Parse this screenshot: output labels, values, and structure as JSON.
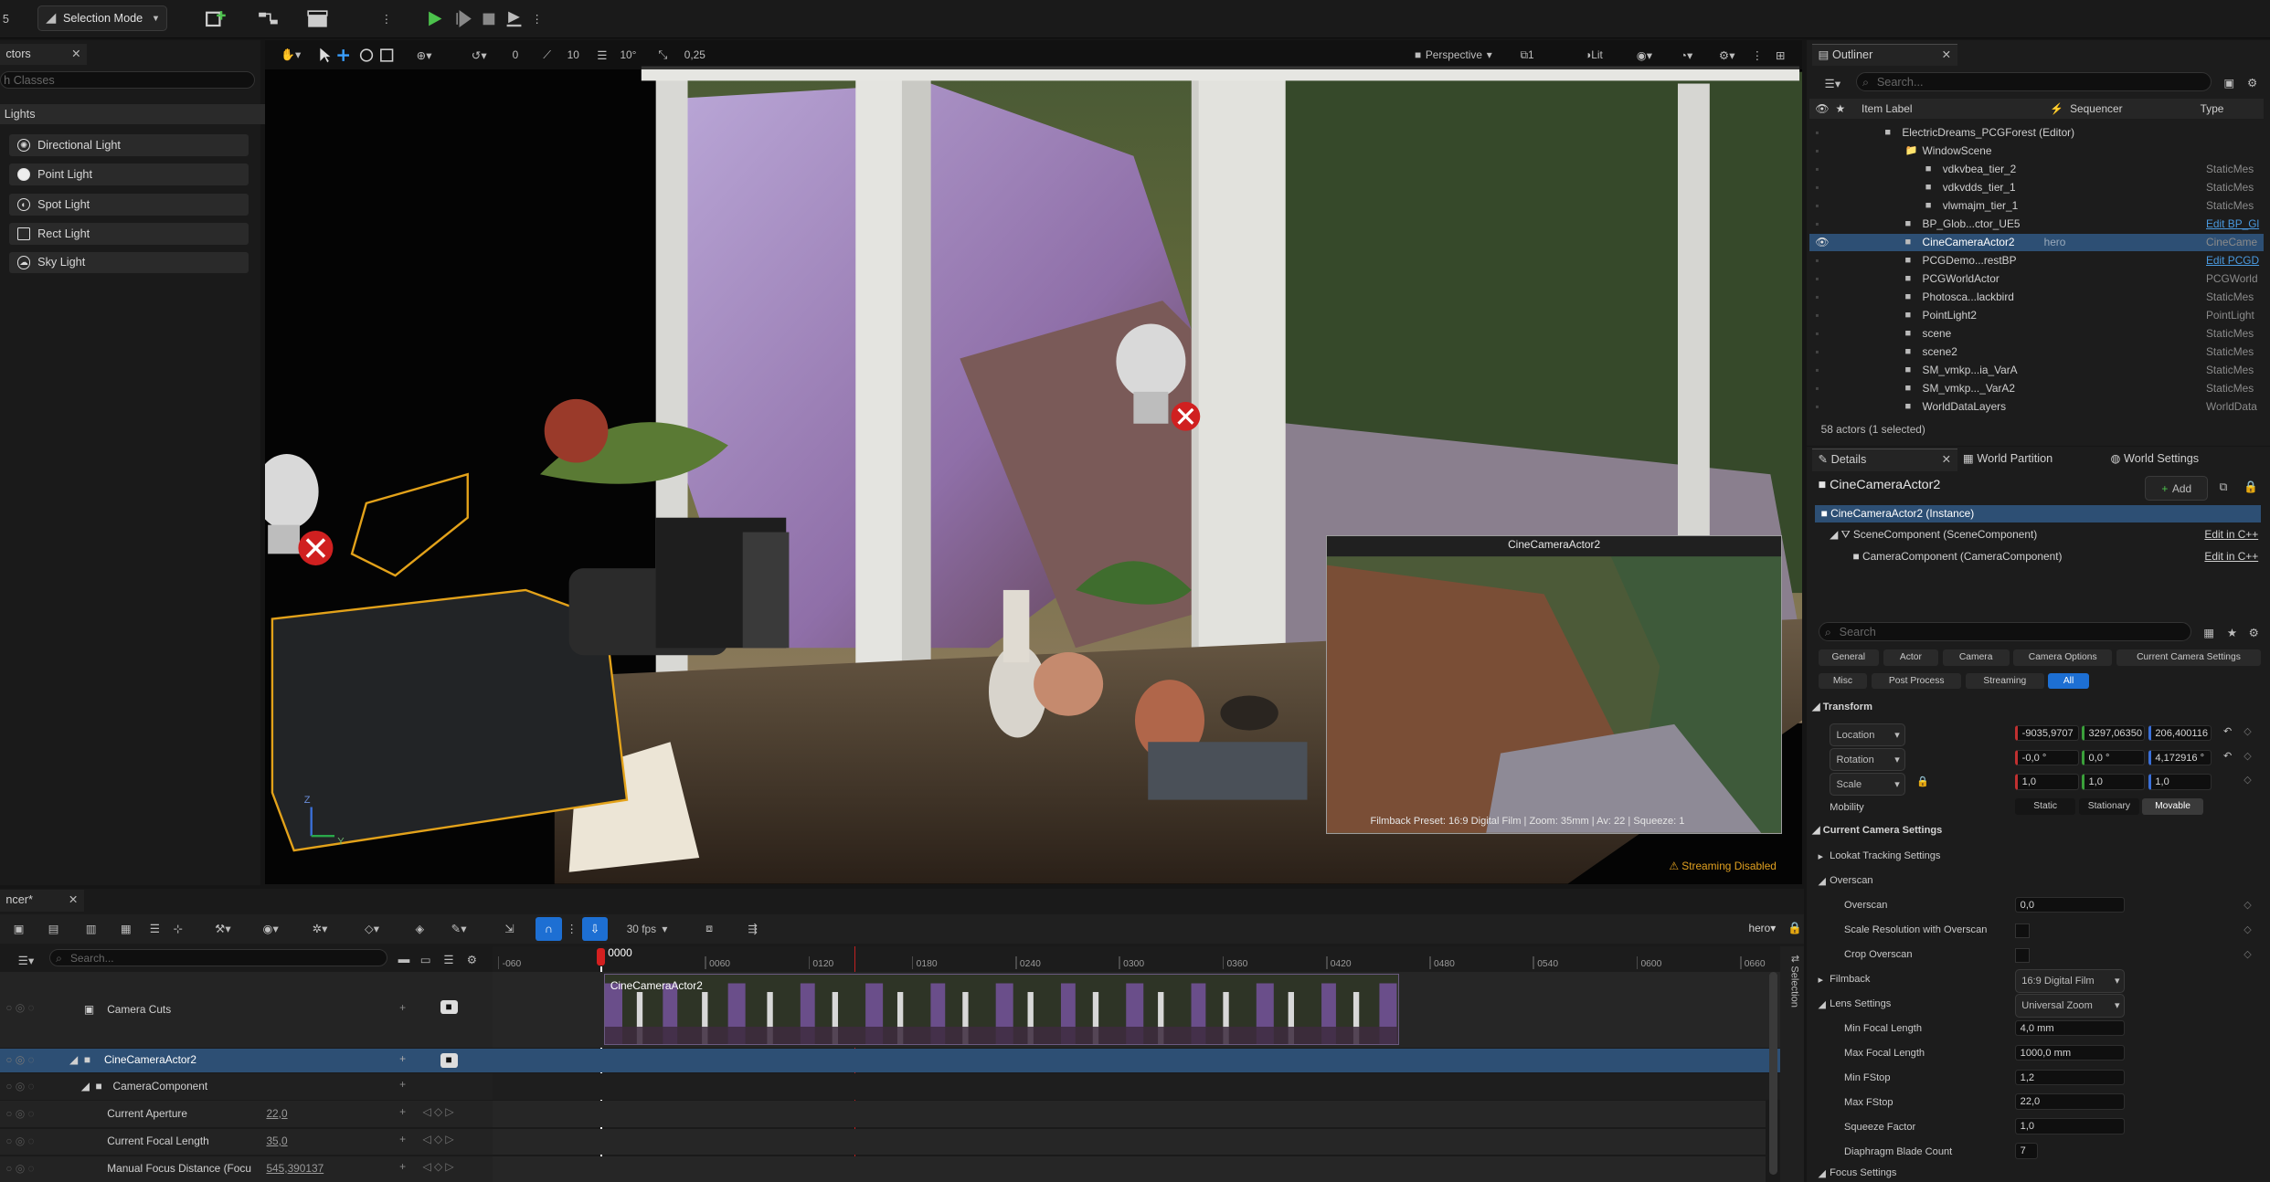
{
  "toolbar": {
    "mode": "Selection Mode",
    "vp_perspective": "Perspective",
    "vp_lit": "Lit",
    "vp_split": "1",
    "snap_grid": "10",
    "snap_rot": "10°",
    "snap_scale": "0,25",
    "vp_rot_snap": "0"
  },
  "place_actors": {
    "tab": "ctors",
    "search_placeholder": "h Classes",
    "category": "Lights",
    "items": [
      "Directional Light",
      "Point Light",
      "Spot Light",
      "Rect Light",
      "Sky Light"
    ]
  },
  "viewport": {
    "pip_title": "CineCameraActor2",
    "pip_info": "Filmback Preset: 16:9 Digital Film | Zoom: 35mm | Av: 22 | Squeeze: 1",
    "streaming": "Streaming Disabled"
  },
  "outliner": {
    "tab": "Outliner",
    "search_placeholder": "Search...",
    "col_label": "Item Label",
    "col_seq": "Sequencer",
    "col_type": "Type",
    "rows": [
      {
        "label": "ElectricDreams_PCGForest (Editor)",
        "type": "",
        "indent": 0
      },
      {
        "label": "WindowScene",
        "type": "",
        "indent": 1
      },
      {
        "label": "vdkvbea_tier_2",
        "type": "StaticMes",
        "indent": 2
      },
      {
        "label": "vdkvdds_tier_1",
        "type": "StaticMes",
        "indent": 2
      },
      {
        "label": "vlwmajm_tier_1",
        "type": "StaticMes",
        "indent": 2
      },
      {
        "label": "BP_Glob...ctor_UE5",
        "type": "Edit BP_Gl",
        "indent": 1
      },
      {
        "label": "CineCameraActor2",
        "type": "CineCame",
        "indent": 1,
        "seq": "hero"
      },
      {
        "label": "PCGDemo...restBP",
        "type": "Edit PCGD",
        "indent": 1
      },
      {
        "label": "PCGWorldActor",
        "type": "PCGWorld",
        "indent": 1
      },
      {
        "label": "Photosca...lackbird",
        "type": "StaticMes",
        "indent": 1
      },
      {
        "label": "PointLight2",
        "type": "PointLight",
        "indent": 1
      },
      {
        "label": "scene",
        "type": "StaticMes",
        "indent": 1
      },
      {
        "label": "scene2",
        "type": "StaticMes",
        "indent": 1
      },
      {
        "label": "SM_vmkp...ia_VarA",
        "type": "StaticMes",
        "indent": 1
      },
      {
        "label": "SM_vmkp..._VarA2",
        "type": "StaticMes",
        "indent": 1
      },
      {
        "label": "WorldDataLayers",
        "type": "WorldData",
        "indent": 1
      }
    ],
    "status": "58 actors (1 selected)"
  },
  "details": {
    "tab": "Details",
    "tab2": "World Partition",
    "tab3": "World Settings",
    "actor_name": "CineCameraActor2",
    "add_label": "Add",
    "instance": "CineCameraActor2 (Instance)",
    "comp1": "SceneComponent (SceneComponent)",
    "comp2": "CameraComponent (CameraComponent)",
    "edit_cpp": "Edit in C++",
    "search_placeholder": "Search",
    "filter_tabs": [
      "General",
      "Actor",
      "Camera",
      "Camera Options",
      "Current Camera Settings",
      "Misc",
      "Post Process",
      "Streaming",
      "All"
    ],
    "transform": "Transform",
    "location": "Location",
    "rotation": "Rotation",
    "scale": "Scale",
    "loc": [
      "-9035,9707",
      "3297,06350",
      "206,400116"
    ],
    "rot": [
      "-0,0 °",
      "0,0 °",
      "4,172916 °"
    ],
    "scl": [
      "1,0",
      "1,0",
      "1,0"
    ],
    "mobility": "Mobility",
    "mob_opts": [
      "Static",
      "Stationary",
      "Movable"
    ],
    "ccs": "Current Camera Settings",
    "lookat": "Lookat Tracking Settings",
    "overscan_sec": "Overscan",
    "overscan": "Overscan",
    "overscan_val": "0,0",
    "scale_res": "Scale Resolution with Overscan",
    "crop": "Crop Overscan",
    "filmback": "Filmback",
    "filmback_val": "16:9 Digital Film",
    "lens": "Lens Settings",
    "lens_val": "Universal Zoom",
    "minfl": "Min Focal Length",
    "minfl_v": "4,0 mm",
    "maxfl": "Max Focal Length",
    "maxfl_v": "1000,0 mm",
    "minf": "Min FStop",
    "minf_v": "1,2",
    "maxf": "Max FStop",
    "maxf_v": "22,0",
    "sq": "Squeeze Factor",
    "sq_v": "1,0",
    "blade": "Diaphragm Blade Count",
    "blade_v": "7",
    "focus": "Focus Settings"
  },
  "sequencer": {
    "tab": "ncer*",
    "fps": "30 fps",
    "search_placeholder": "Search...",
    "seq_name": "hero",
    "current_frame": "0000",
    "ticks": [
      "-060",
      "0000",
      "0060",
      "0120",
      "0180",
      "0240",
      "0300",
      "0360",
      "0420",
      "0480",
      "0540",
      "0600",
      "0660"
    ],
    "camera_cuts": "Camera Cuts",
    "track_actor": "CineCameraActor2",
    "track_comp": "CameraComponent",
    "ap": "Current Aperture",
    "ap_v": "22,0",
    "fl": "Current Focal Length",
    "fl_v": "35,0",
    "mfd": "Manual Focus Distance (Focu",
    "mfd_v": "545,390137",
    "clip": "CineCameraActor2",
    "selection": "Selection"
  }
}
